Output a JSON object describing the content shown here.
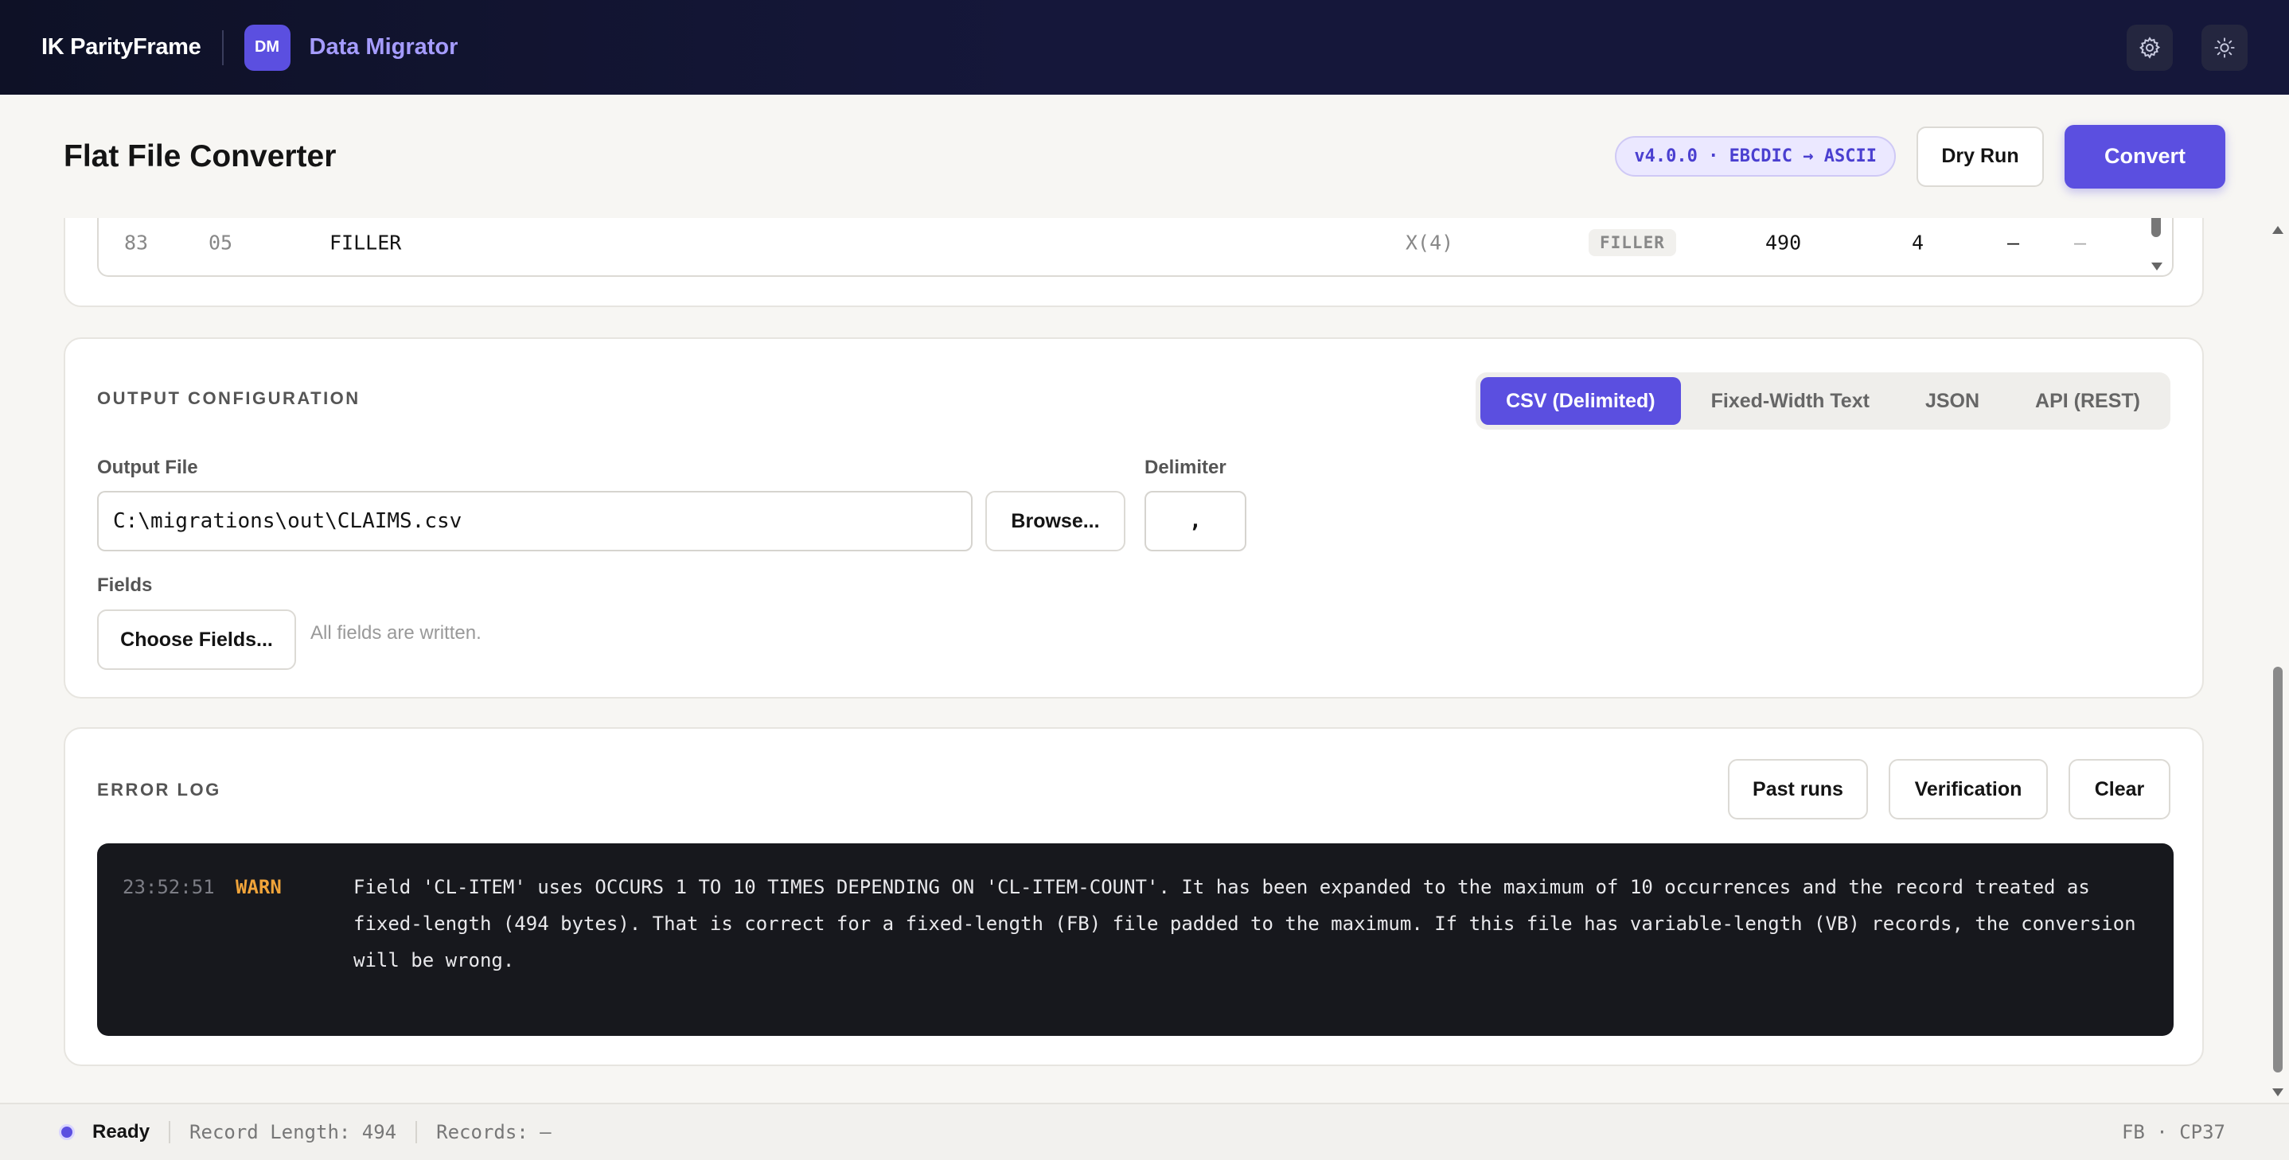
{
  "topbar": {
    "brand": "IK ParityFrame",
    "badge": "DM",
    "app_name": "Data Migrator",
    "icons": [
      "gear-icon",
      "sun-icon"
    ]
  },
  "header": {
    "title": "Flat File Converter",
    "version": "v4.0.0 · EBCDIC → ASCII",
    "dry_run_label": "Dry Run",
    "convert_label": "Convert"
  },
  "field_table": {
    "rows": [
      {
        "num": "83",
        "level": "05",
        "name": "FILLER",
        "pic": "X(4)",
        "type": "FILLER",
        "offset": "490",
        "length": "4",
        "col_a": "—",
        "col_b": "—"
      }
    ]
  },
  "output": {
    "section_label": "OUTPUT CONFIGURATION",
    "formats": [
      "CSV (Delimited)",
      "Fixed-Width Text",
      "JSON",
      "API (REST)"
    ],
    "active_format": "CSV (Delimited)",
    "output_file_label": "Output File",
    "output_file_value": "C:\\migrations\\out\\CLAIMS.csv",
    "browse_label": "Browse...",
    "delimiter_label": "Delimiter",
    "delimiter_value": ",",
    "fields_label": "Fields",
    "choose_fields_label": "Choose Fields...",
    "fields_hint": "All fields are written."
  },
  "error_log": {
    "section_label": "ERROR LOG",
    "past_runs_label": "Past runs",
    "verification_label": "Verification",
    "clear_label": "Clear",
    "entries": [
      {
        "time": "23:52:51",
        "level": "WARN",
        "message": "Field 'CL-ITEM' uses OCCURS 1 TO 10 TIMES DEPENDING ON 'CL-ITEM-COUNT'. It has been expanded to the maximum of 10 occurrences and the record treated as fixed-length (494 bytes). That is correct for a fixed-length (FB) file padded to the maximum. If this file has variable-length (VB) records, the conversion will be wrong."
      }
    ]
  },
  "status": {
    "state": "Ready",
    "record_length": "Record Length: 494",
    "records": "Records: —",
    "right": "FB · CP37"
  },
  "colors": {
    "accent": "#5b4fe0",
    "warn": "#f0a43a",
    "topbar": "#15173a"
  }
}
